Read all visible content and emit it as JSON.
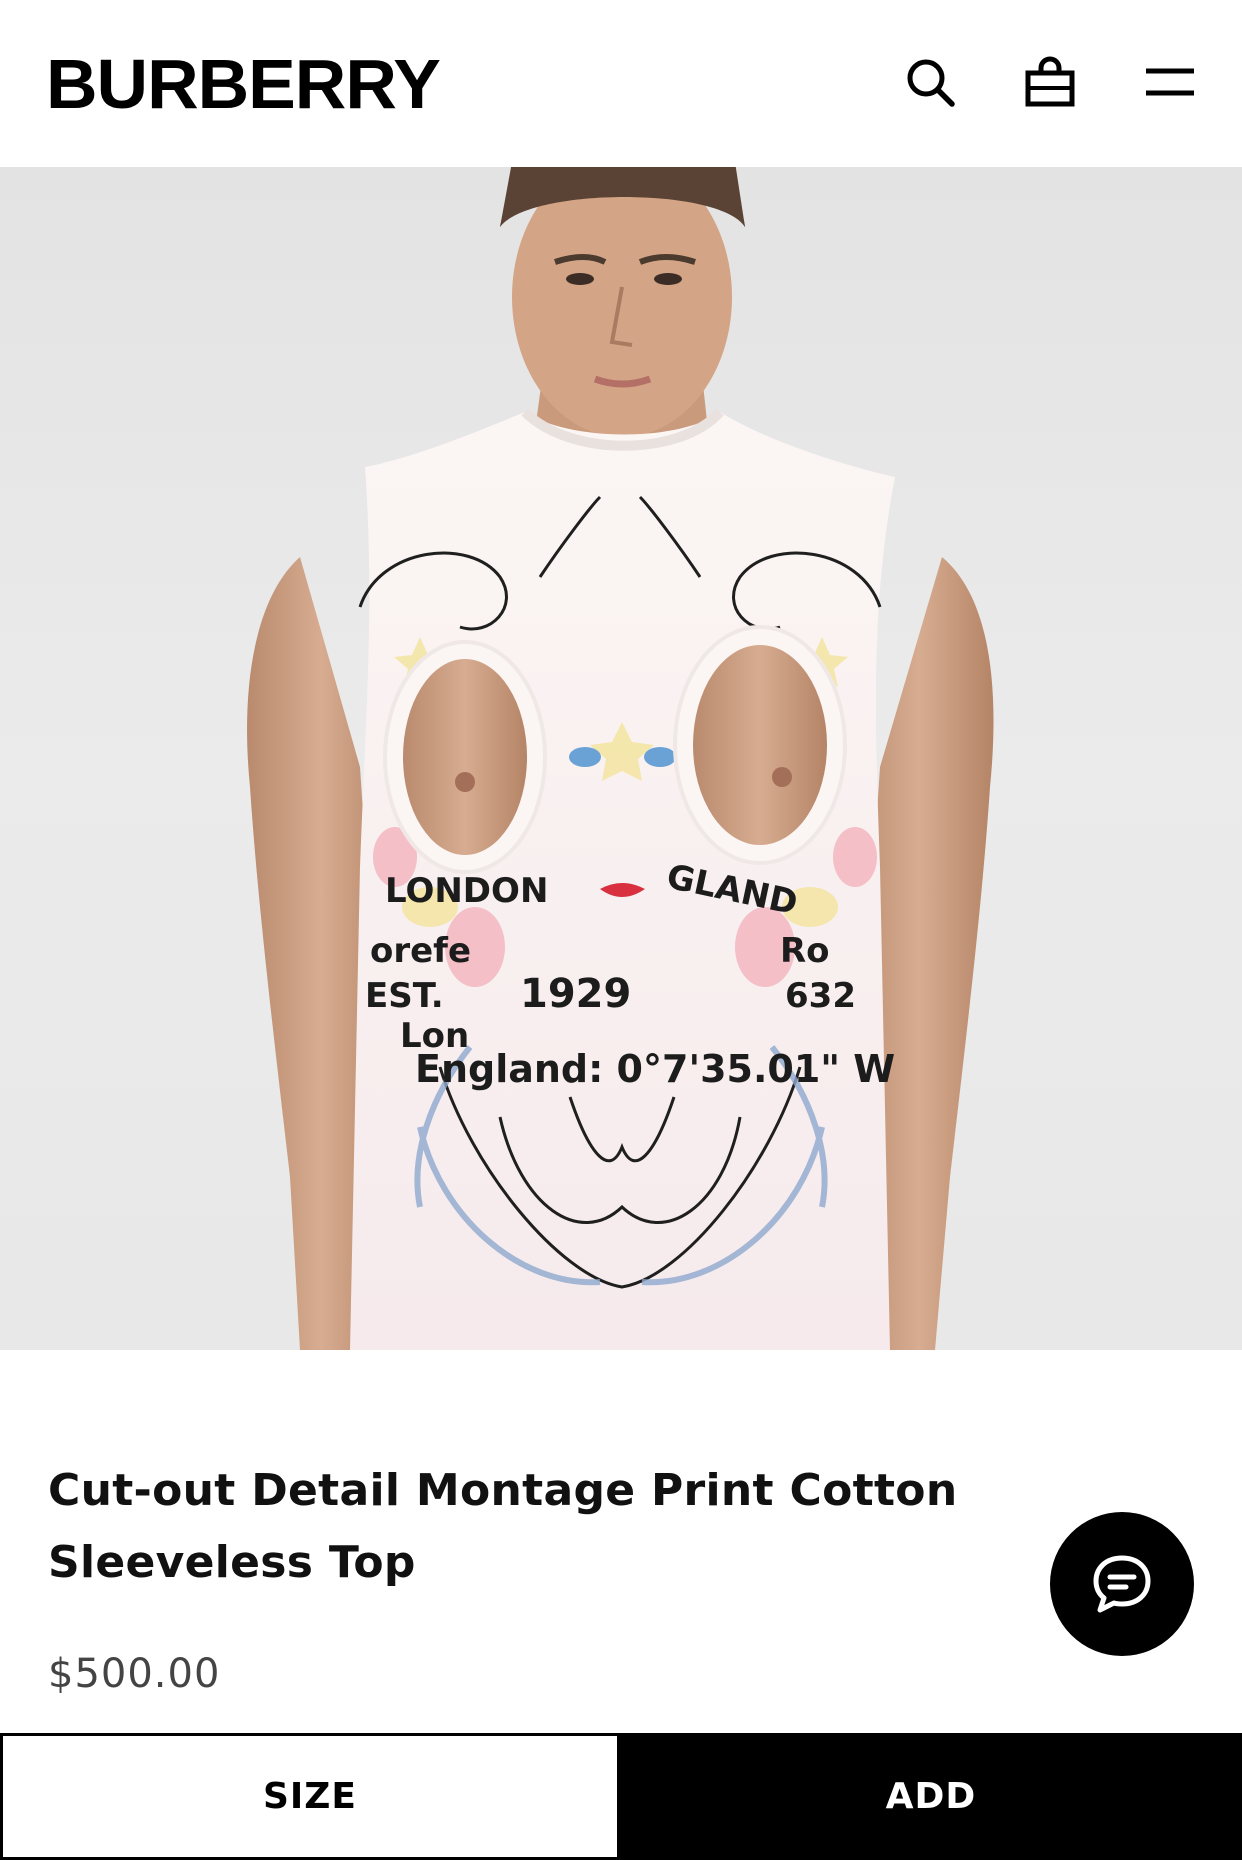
{
  "header": {
    "logo": "BURBERRY",
    "icons": [
      "search-icon",
      "bag-icon",
      "menu-icon"
    ]
  },
  "product": {
    "image_alt": "Model wearing white sleeveless top with cut-out detail and montage print",
    "print_text": [
      "ENGLAND",
      "LONDON",
      "0°7'35.01\" W",
      "1929",
      "Horseferry Road",
      "EST."
    ],
    "title": "Cut-out Detail Montage Print Cotton Sleeveless Top",
    "price": "$500.00"
  },
  "chat": {
    "icon": "chat-icon"
  },
  "actions": {
    "size_label": "SIZE",
    "add_label": "ADD"
  },
  "colors": {
    "primary": "#000000",
    "background": "#ffffff",
    "price_text": "#444444",
    "hero_bg": "#e6e6e6"
  }
}
